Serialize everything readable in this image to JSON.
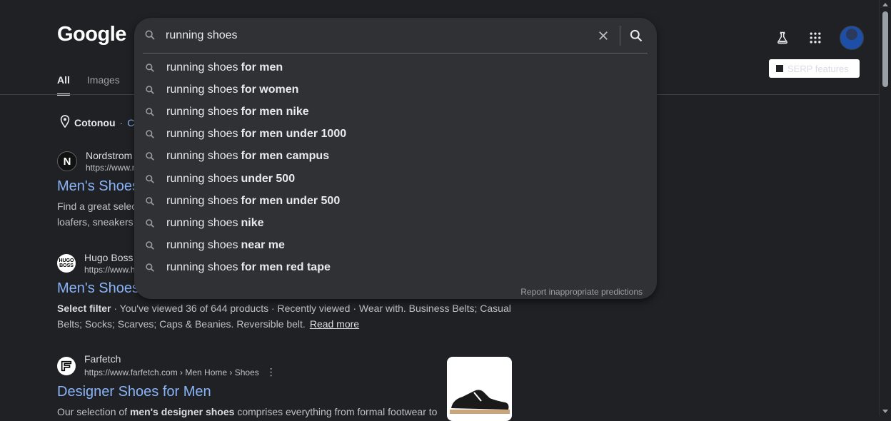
{
  "header": {
    "logo_text": "Google",
    "serp_button_label": "SERP features"
  },
  "tabs": [
    {
      "label": "All",
      "active": true
    },
    {
      "label": "Images",
      "active": false
    }
  ],
  "location": {
    "city": "Cotonou",
    "separator": "·",
    "change_label": "Ch"
  },
  "search": {
    "query": "running shoes",
    "suggestions": [
      {
        "prefix": "running shoes",
        "suffix": "for men"
      },
      {
        "prefix": "running shoes",
        "suffix": "for women"
      },
      {
        "prefix": "running shoes",
        "suffix": "for men nike"
      },
      {
        "prefix": "running shoes",
        "suffix": "for men under 1000"
      },
      {
        "prefix": "running shoes",
        "suffix": "for men campus"
      },
      {
        "prefix": "running shoes",
        "suffix": "under 500"
      },
      {
        "prefix": "running shoes",
        "suffix": "for men under 500"
      },
      {
        "prefix": "running shoes",
        "suffix": "nike"
      },
      {
        "prefix": "running shoes",
        "suffix": "near me"
      },
      {
        "prefix": "running shoes",
        "suffix": "for men red tape"
      }
    ],
    "report_label": "Report inappropriate predictions"
  },
  "results": [
    {
      "source": "Nordstrom",
      "favicon_letter": "N",
      "url": "https://www.n",
      "title": "Men's Shoes",
      "snippet_line1": "Find a great selec",
      "snippet_line2": "loafers, sneakers,"
    },
    {
      "source": "Hugo Boss",
      "favicon_text": "HUGO BOSS",
      "url": "https://www.h",
      "title": "Men's Shoes",
      "snippet_bold": "Select filter",
      "snippet_rest": " · You've viewed 36 of 644 products · Recently viewed · Wear with. Business Belts; Casual",
      "snippet_line2": "Belts; Socks; Scarves; Caps & Beanies. Reversible belt.",
      "read_more": "Read more"
    },
    {
      "source": "Farfetch",
      "favicon_letter": "F",
      "url": "https://www.farfetch.com › Men Home › Shoes",
      "title": "Designer Shoes for Men",
      "snippet_start": "Our selection of ",
      "snippet_bold": "men's designer shoes",
      "snippet_end": " comprises everything from formal footwear to"
    }
  ],
  "icons": {
    "search": "search-icon",
    "clear": "close-icon",
    "labs": "flask-icon",
    "apps": "apps-grid-icon",
    "location": "location-pin-icon",
    "more": "kebab-icon"
  },
  "colors": {
    "background": "#202124",
    "dropdown": "#303134",
    "link": "#8ab4f8",
    "text": "#e8eaed",
    "muted": "#9aa0a6"
  }
}
